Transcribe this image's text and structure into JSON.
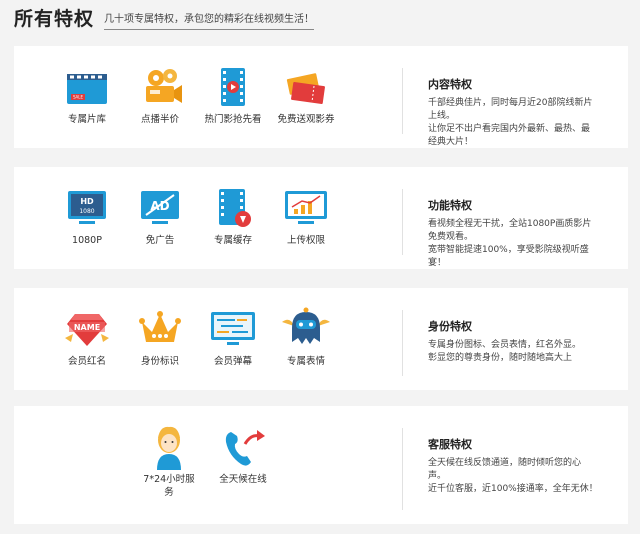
{
  "header": {
    "title": "所有特权",
    "subtitle": "几十项专属特权，承包您的精彩在线视频生活！"
  },
  "cards": [
    {
      "features": [
        {
          "label": "专属片库",
          "icon": "film-library-icon"
        },
        {
          "label": "点播半价",
          "icon": "movie-camera-icon"
        },
        {
          "label": "热门影抢先看",
          "icon": "film-play-icon"
        },
        {
          "label": "免费送观影券",
          "icon": "movie-ticket-icon"
        }
      ],
      "title": "内容特权",
      "lines": [
        "千部经典佳片，同时每月近20部院线新片上线。",
        "让你足不出户看完国内外最新、最热、最经典大片！"
      ]
    },
    {
      "features": [
        {
          "label": "1080P",
          "icon": "hd-1080-icon"
        },
        {
          "label": "免广告",
          "icon": "ad-free-icon"
        },
        {
          "label": "专属缓存",
          "icon": "download-cache-icon"
        },
        {
          "label": "上传权限",
          "icon": "upload-chart-icon"
        }
      ],
      "title": "功能特权",
      "lines": [
        "看视频全程无干扰，全站1080P画质影片免费观看。",
        "宽带智能提速100%，享受影院级视听盛宴！"
      ]
    },
    {
      "features": [
        {
          "label": "会员红名",
          "icon": "name-gem-icon"
        },
        {
          "label": "身份标识",
          "icon": "crown-icon"
        },
        {
          "label": "会员弹幕",
          "icon": "danmaku-screen-icon"
        },
        {
          "label": "专属表情",
          "icon": "emoji-mascot-icon"
        }
      ],
      "title": "身份特权",
      "lines": [
        "专属身份图标、会员表情，红名外显。",
        "彰显您的尊贵身份，随时随地高大上"
      ]
    },
    {
      "features": [
        {
          "label": "7*24小时服务",
          "icon": "service-agent-icon"
        },
        {
          "label": "全天候在线",
          "icon": "phone-callback-icon"
        }
      ],
      "title": "客服特权",
      "lines": [
        "全天候在线反馈通道，随时倾听您的心声。",
        "近千位客服，近100%接通率，全年无休！"
      ]
    }
  ],
  "colors": {
    "blue": "#1f9ad6",
    "orange": "#f5a623",
    "red": "#e23c3c",
    "navy": "#2c5d8f",
    "gold": "#f4b63f"
  }
}
